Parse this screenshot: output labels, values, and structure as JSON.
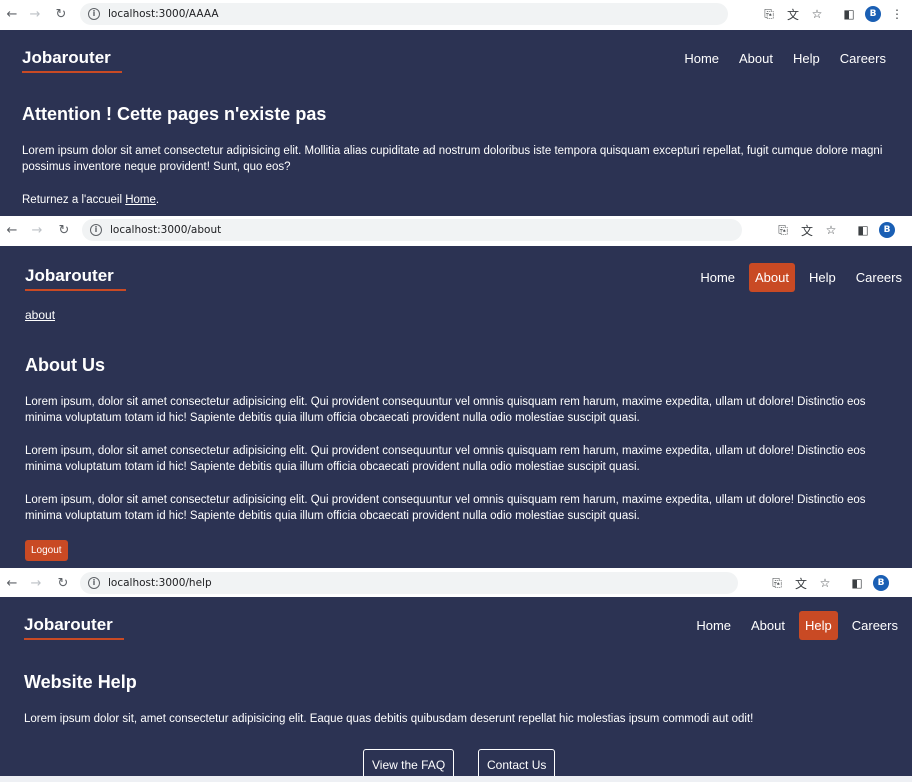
{
  "shot1": {
    "url": "localhost:3000/AAAA",
    "brand": "Jobarouter",
    "nav": [
      "Home",
      "About",
      "Help",
      "Careers"
    ],
    "title": "Attention ! Cette pages n'existe pas",
    "text": "Lorem ipsum dolor sit amet consectetur adipisicing elit. Mollitia alias cupiditate ad nostrum doloribus iste tempora quisquam excepturi repellat, fugit cumque dolore magni possimus inventore neque provident! Sunt, quo eos?",
    "return_prefix": "Returnez a l'accueil",
    "return_link": "Home",
    "return_suffix": "."
  },
  "shot2": {
    "url": "localhost:3000/about",
    "brand": "Jobarouter",
    "nav": [
      "Home",
      "About",
      "Help",
      "Careers"
    ],
    "active_nav": "About",
    "breadcrumb": "about",
    "title": "About Us",
    "paragraphs": [
      "Lorem ipsum, dolor sit amet consectetur adipisicing elit. Qui provident consequuntur vel omnis quisquam rem harum, maxime expedita, ullam ut dolore! Distinctio eos minima voluptatum totam id hic! Sapiente debitis quia illum officia obcaecati provident nulla odio molestiae suscipit quasi.",
      "Lorem ipsum, dolor sit amet consectetur adipisicing elit. Qui provident consequuntur vel omnis quisquam rem harum, maxime expedita, ullam ut dolore! Distinctio eos minima voluptatum totam id hic! Sapiente debitis quia illum officia obcaecati provident nulla odio molestiae suscipit quasi.",
      "Lorem ipsum, dolor sit amet consectetur adipisicing elit. Qui provident consequuntur vel omnis quisquam rem harum, maxime expedita, ullam ut dolore! Distinctio eos minima voluptatum totam id hic! Sapiente debitis quia illum officia obcaecati provident nulla odio molestiae suscipit quasi."
    ],
    "logout": "Logout"
  },
  "shot3": {
    "url": "localhost:3000/help",
    "brand": "Jobarouter",
    "nav": [
      "Home",
      "About",
      "Help",
      "Careers"
    ],
    "active_nav": "Help",
    "title": "Website Help",
    "text": "Lorem ipsum dolor sit, amet consectetur adipisicing elit. Eaque quas debitis quibusdam deserunt repellat hic molestias ipsum commodi aut odit!",
    "buttons": [
      "View the FAQ",
      "Contact Us"
    ]
  },
  "browser": {
    "avatar_letter": "B",
    "colors": {
      "app_bg": "#2c3353",
      "accent": "#c94a24",
      "avatar": "#1a5fb4"
    }
  }
}
